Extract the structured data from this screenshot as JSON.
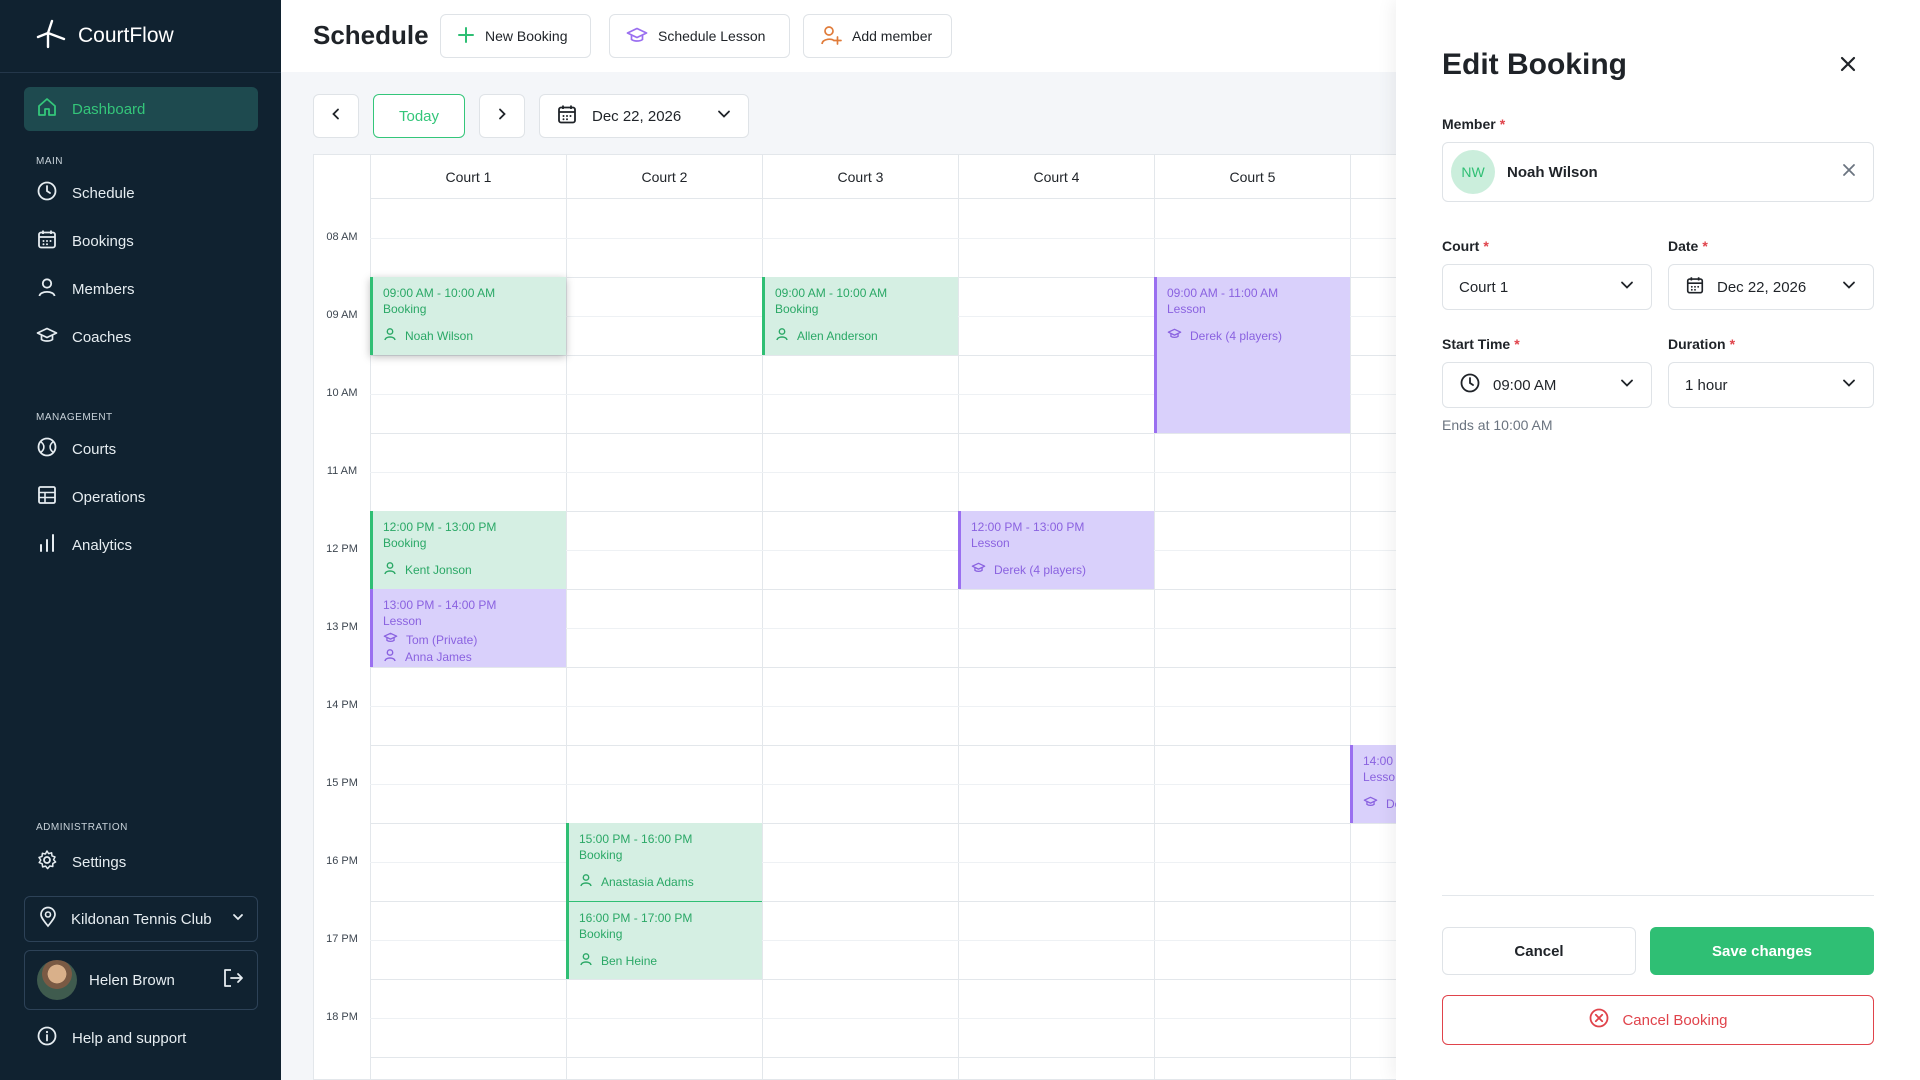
{
  "app": {
    "name": "CourtFlow"
  },
  "sidebar": {
    "dashboard": "Dashboard",
    "sections": {
      "main": "MAIN",
      "management": "MANAGEMENT",
      "administration": "ADMINISTRATION"
    },
    "main_items": [
      "Schedule",
      "Bookings",
      "Members",
      "Coaches"
    ],
    "management_items": [
      "Courts",
      "Operations",
      "Analytics"
    ],
    "settings": "Settings",
    "club": "Kildonan Tennis Club",
    "user": "Helen Brown",
    "help": "Help and support",
    "accent_color": "#34c67a"
  },
  "header": {
    "title": "Schedule",
    "new_booking": "New Booking",
    "schedule_lesson": "Schedule Lesson",
    "add_member": "Add member"
  },
  "calendar": {
    "today": "Today",
    "date": "Dec 22, 2026",
    "courts": [
      "Court 1",
      "Court 2",
      "Court 3",
      "Court 4",
      "Court 5"
    ],
    "times": [
      "08 AM",
      "09 AM",
      "10 AM",
      "11 AM",
      "12 PM",
      "13 PM",
      "14 PM",
      "15 PM",
      "16 PM",
      "17 PM",
      "18 PM"
    ],
    "events": [
      {
        "time": "09:00 AM - 10:00 AM",
        "kind": "Booking",
        "who": [
          "Noah Wilson"
        ]
      },
      {
        "time": "09:00 AM - 10:00 AM",
        "kind": "Booking",
        "who": [
          "Allen Anderson"
        ]
      },
      {
        "time": "09:00 AM - 11:00 AM",
        "kind": "Lesson",
        "who": [
          "Derek (4 players)"
        ]
      },
      {
        "time": "12:00 PM - 13:00 PM",
        "kind": "Booking",
        "who": [
          "Kent Jonson"
        ]
      },
      {
        "time": "12:00 PM - 13:00 PM",
        "kind": "Lesson",
        "who": [
          "Derek (4 players)"
        ]
      },
      {
        "time": "13:00 PM - 14:00 PM",
        "kind": "Lesson",
        "who": [
          "Tom (Private)",
          "Anna James"
        ]
      },
      {
        "time": "14:00",
        "kind": "Lesso",
        "who": [
          "De"
        ]
      },
      {
        "time": "15:00 PM - 16:00 PM",
        "kind": "Booking",
        "who": [
          "Anastasia Adams"
        ]
      },
      {
        "time": "16:00 PM - 17:00 PM",
        "kind": "Booking",
        "who": [
          "Ben Heine"
        ]
      }
    ],
    "booking_color": "#2fbf74",
    "lesson_color": "#9a6ff0"
  },
  "drawer": {
    "title": "Edit Booking",
    "member_label": "Member",
    "member_initials": "NW",
    "member_name": "Noah Wilson",
    "court_label": "Court",
    "court_value": "Court 1",
    "date_label": "Date",
    "date_value": "Dec 22, 2026",
    "start_label": "Start Time",
    "start_value": "09:00 AM",
    "duration_label": "Duration",
    "duration_value": "1 hour",
    "ends_at": "Ends at 10:00 AM",
    "required_mark": "*",
    "cancel": "Cancel",
    "save": "Save changes",
    "cancel_booking": "Cancel Booking",
    "danger_color": "#e0434b"
  }
}
